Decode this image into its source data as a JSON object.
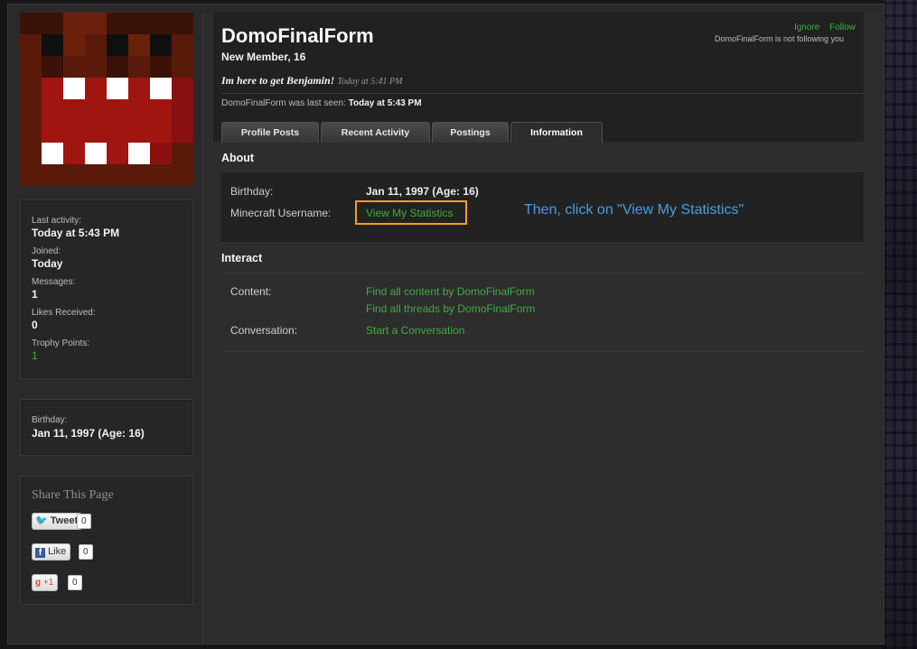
{
  "profile": {
    "username": "DomoFinalForm",
    "user_title": "New Member, 16",
    "status_text": "Im here to get Benjamin!",
    "status_time": "Today at 5:41 PM",
    "last_seen_prefix": "DomoFinalForm was last seen:",
    "last_seen_time": "Today at 5:43 PM",
    "ignore_label": "Ignore",
    "follow_label": "Follow",
    "following_status": "DomoFinalForm is not following you"
  },
  "tabs": [
    {
      "label": "Profile Posts"
    },
    {
      "label": "Recent Activity"
    },
    {
      "label": "Postings"
    },
    {
      "label": "Information"
    }
  ],
  "active_tab": "Information",
  "sidebar": {
    "stats": [
      {
        "label": "Last activity:",
        "value": "Today at 5:43 PM"
      },
      {
        "label": "Joined:",
        "value": "Today"
      },
      {
        "label": "Messages:",
        "value": "1"
      },
      {
        "label": "Likes Received:",
        "value": "0"
      },
      {
        "label": "Trophy Points:",
        "value": "1"
      }
    ],
    "birthday_label": "Birthday:",
    "birthday_value": "Jan 11, 1997 (Age: 16)",
    "share_title": "Share This Page",
    "tweet_label": "Tweet",
    "tweet_count": "0",
    "like_label": "Like",
    "like_count": "0",
    "plusone_label": "+1",
    "plusone_count": "0"
  },
  "about": {
    "title": "About",
    "birthday_label": "Birthday:",
    "birthday_value": "Jan 11, 1997 (Age: 16)",
    "minecraft_label": "Minecraft Username:",
    "minecraft_link": "View My Statistics"
  },
  "interact": {
    "title": "Interact",
    "content_label": "Content:",
    "content_link_1": "Find all content by DomoFinalForm",
    "content_link_2": "Find all threads by DomoFinalForm",
    "conversation_label": "Conversation:",
    "conversation_link": "Start a Conversation"
  },
  "annotation": "Then, click on \"View My Statistics\"",
  "colors": {
    "link_green": "#3fae3f",
    "highlight_orange": "#f0a020",
    "annotation_blue": "#4a9ce0"
  }
}
